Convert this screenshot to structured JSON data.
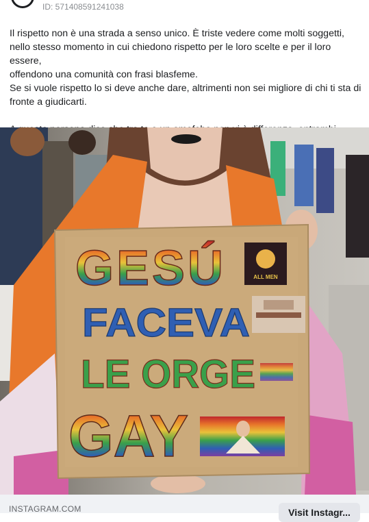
{
  "post": {
    "id_text": "ID: 571408591241038",
    "caption_p1": "Il rispetto non è una strada a senso unico. È triste vedere come molti soggetti,\nnello stesso momento in cui chiedono rispetto per le loro scelte e per il loro essere,\noffendono una comunità con frasi blasfeme.\nSe si vuole rispetto lo si deve anche dare, altrimenti non sei migliore di chi ti sta di\nfronte a giudicarti.",
    "caption_p2": "A questa persona dico che tra te e un omofobo non vi è differenza, entrambi non…"
  },
  "sign": {
    "line1": "GESÚ",
    "line2": "FACEVA",
    "line3": "LE ORGE",
    "line4": "GAY",
    "sticker_text": "ALL MEN"
  },
  "footer": {
    "domain": "INSTAGRAM.COM",
    "button_label": "Visit Instagr..."
  },
  "colors": {
    "accent_red": "#c0272d",
    "accent_orange": "#e8752a",
    "accent_yellow": "#e9c23a",
    "accent_green": "#3aa04a",
    "accent_blue": "#2f5fb3",
    "accent_purple": "#7b3fa0",
    "flag_orange": "#e8782b",
    "flag_pink": "#d25fa2",
    "cardboard": "#c9a879"
  }
}
